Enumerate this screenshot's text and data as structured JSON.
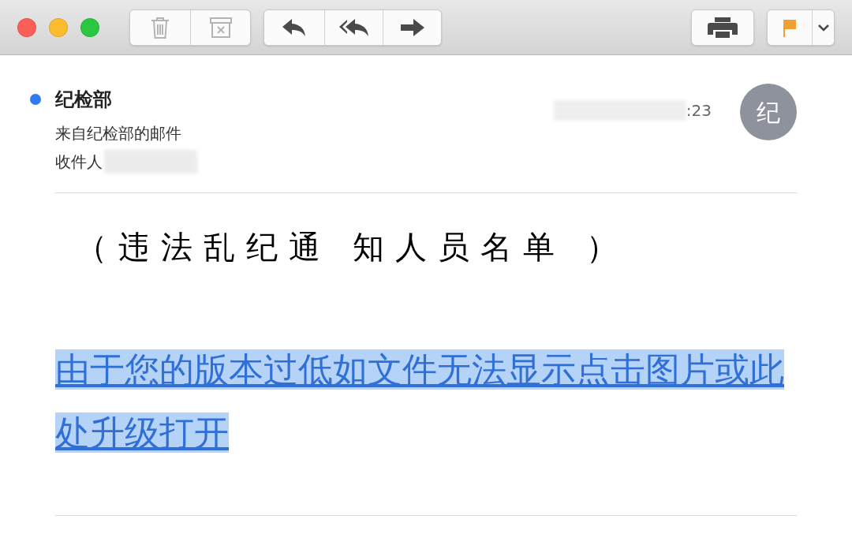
{
  "window": {
    "traffic_lights": [
      {
        "kind": "close"
      },
      {
        "kind": "minimize"
      },
      {
        "kind": "zoom"
      }
    ]
  },
  "toolbar": {
    "groups": [
      {
        "buttons": [
          {
            "kind": "trash",
            "disabled": true
          },
          {
            "kind": "junk",
            "disabled": true
          }
        ]
      },
      {
        "buttons": [
          {
            "kind": "reply",
            "disabled": false
          },
          {
            "kind": "reply_all",
            "disabled": false
          },
          {
            "kind": "forward",
            "disabled": false
          }
        ]
      },
      {
        "buttons": [
          {
            "kind": "print",
            "disabled": false
          }
        ]
      },
      {
        "buttons": [
          {
            "kind": "flag",
            "disabled": false,
            "color": "#f0a030"
          },
          {
            "kind": "dropdown",
            "disabled": false
          }
        ]
      }
    ]
  },
  "message": {
    "sender": "纪检部",
    "unread": true,
    "subject": "来自纪检部的邮件",
    "recipient_label": "收件人",
    "time": ":23",
    "avatar": "纪"
  },
  "body": {
    "heading": "（违法乱纪通 知人员名单 ）",
    "link": {
      "text": " 由于您的版本过低如文件无法显示点击图片或此处升级打开",
      "selected": true
    }
  }
}
